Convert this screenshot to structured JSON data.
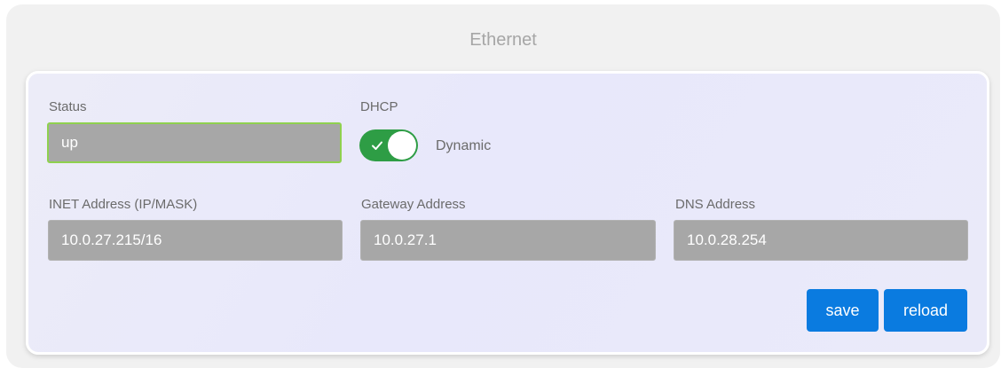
{
  "panel": {
    "title": "Ethernet"
  },
  "form": {
    "status": {
      "label": "Status",
      "value": "up"
    },
    "dhcp": {
      "label": "DHCP",
      "enabled": true,
      "state_text": "Dynamic"
    },
    "inet": {
      "label": "INET Address (IP/MASK)",
      "value": "10.0.27.215/16"
    },
    "gateway": {
      "label": "Gateway Address",
      "value": "10.0.27.1"
    },
    "dns": {
      "label": "DNS Address",
      "value": "10.0.28.254"
    }
  },
  "actions": {
    "save_label": "save",
    "reload_label": "reload"
  },
  "colors": {
    "toggle_on": "#2e9d45",
    "button": "#0a7be0",
    "input_bg": "#a7a7a7",
    "valid_border": "#8fd14f"
  },
  "icons": {
    "toggle_check": "check-icon"
  }
}
